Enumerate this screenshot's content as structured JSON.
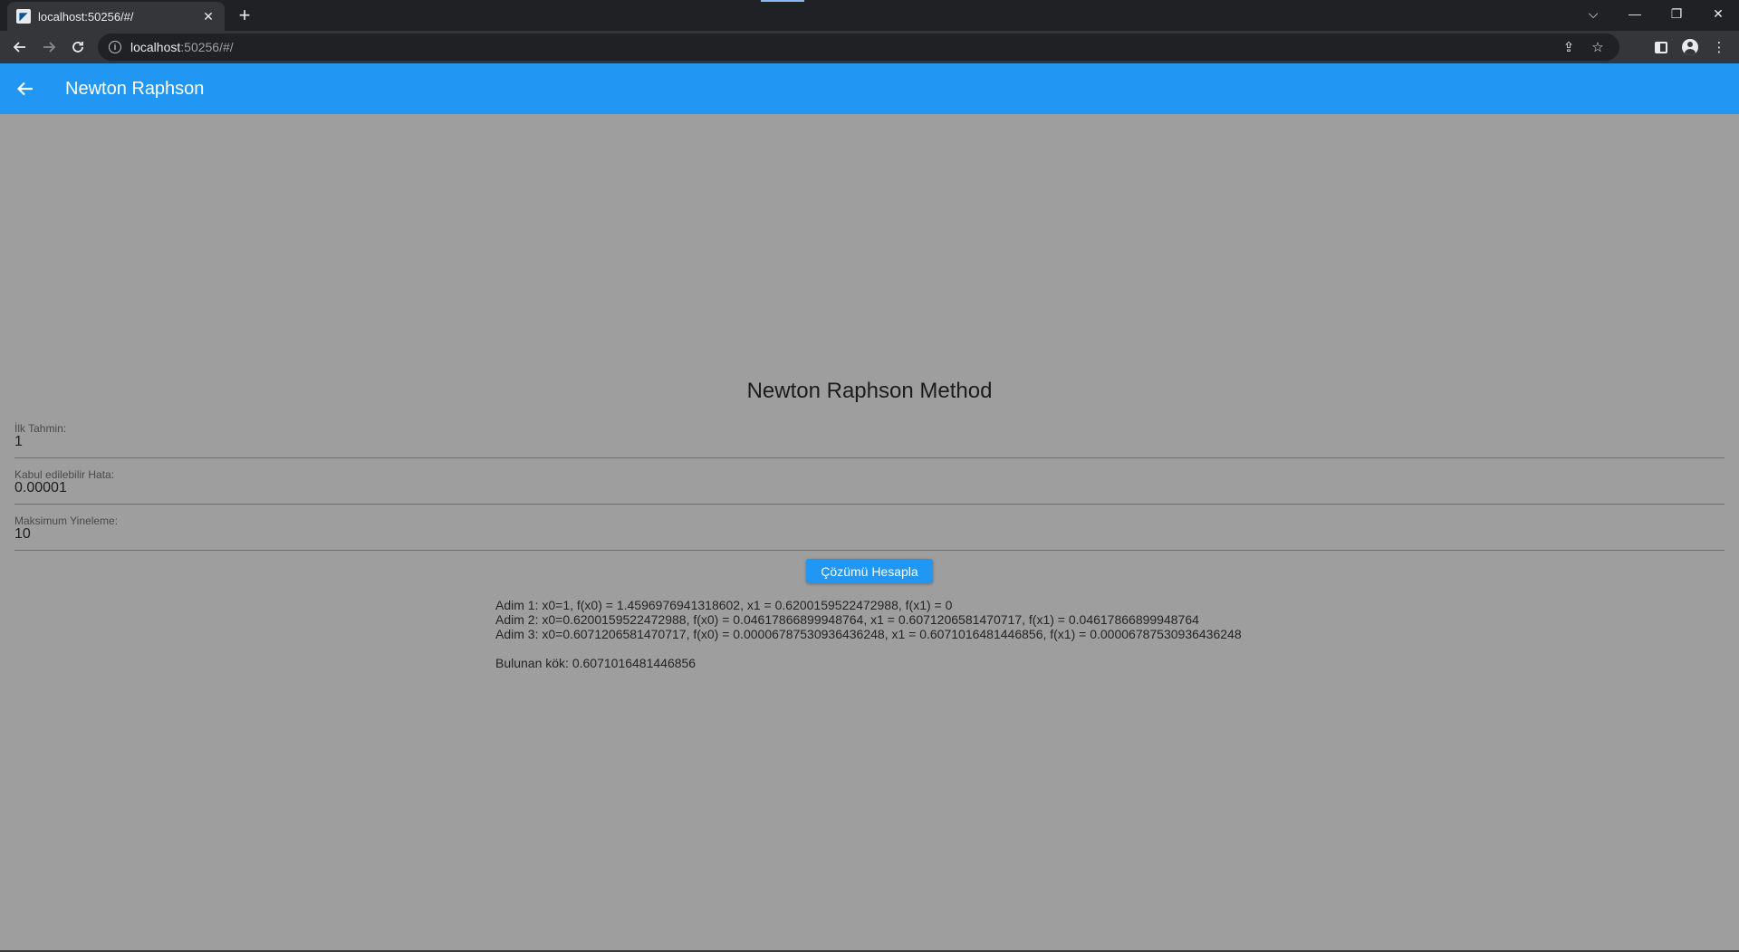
{
  "browser": {
    "tab_title": "localhost:50256/#/",
    "tab_close": "✕",
    "new_tab": "+",
    "url_host": "localhost",
    "url_rest": ":50256/#/",
    "window_controls": [
      "⌵",
      "—",
      "❐",
      "✕"
    ]
  },
  "appbar": {
    "title": "Newton Raphson",
    "back_icon": "arrow-back-icon"
  },
  "main": {
    "heading": "Newton Raphson Method",
    "fields": [
      {
        "label": "İlk Tahmin:",
        "value": "1"
      },
      {
        "label": "Kabul edilebilir Hata:",
        "value": "0.00001"
      },
      {
        "label": "Maksimum Yineleme:",
        "value": "10"
      }
    ],
    "button_label": "Çözümü Hesapla",
    "steps": [
      "Adim 1: x0=1, f(x0) = 1.4596976941318602, x1 = 0.6200159522472988, f(x1) = 0",
      "Adim 2: x0=0.6200159522472988, f(x0) = 0.04617866899948764, x1 = 0.6071206581470717, f(x1) = 0.04617866899948764",
      "Adim 3: x0=0.6071206581470717, f(x0) = 0.00006787530936436248, x1 = 0.6071016481446856, f(x1) = 0.00006787530936436248"
    ],
    "root_text": "Bulunan kök: 0.6071016481446856"
  },
  "colors": {
    "appbar": "#2196f3",
    "background": "#9e9e9e",
    "browser_dark": "#202124",
    "browser_toolbar": "#35363a"
  }
}
